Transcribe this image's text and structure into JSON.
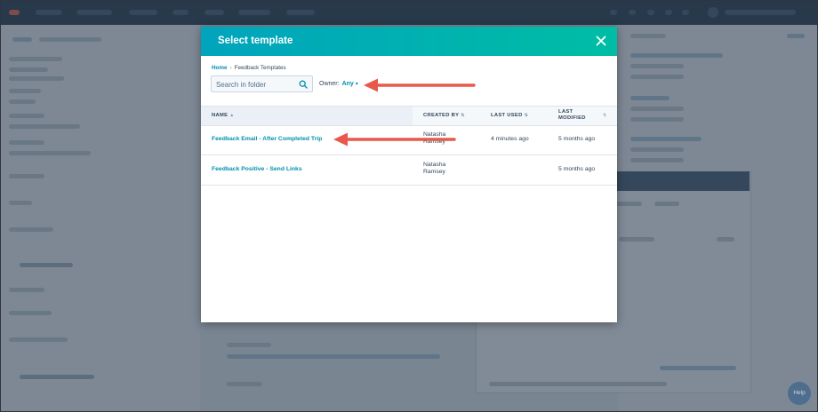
{
  "modal": {
    "title": "Select template",
    "breadcrumb": {
      "home": "Home",
      "separator": "›",
      "current": "Feedback Templates"
    },
    "search": {
      "placeholder": "Search in folder",
      "value": ""
    },
    "owner": {
      "label": "Owner:",
      "value": "Any"
    },
    "table": {
      "columns": {
        "name": "NAME",
        "created_by": "CREATED BY",
        "last_used": "LAST USED",
        "last_modified": "LAST MODIFIED"
      },
      "rows": [
        {
          "name": "Feedback Email - After Completed Trip",
          "created_by": "Natasha Ramsey",
          "last_used": "4 minutes ago",
          "last_modified": "5 months ago"
        },
        {
          "name": "Feedback Positive - Send Links",
          "created_by": "Natasha Ramsey",
          "last_used": "",
          "last_modified": "5 months ago"
        }
      ]
    }
  },
  "help": {
    "label": "Help"
  },
  "colors": {
    "header_start": "#00a4bd",
    "header_end": "#00bda5",
    "link": "#0091ae",
    "annotation_arrow": "#e8594b"
  },
  "icons": {
    "close": "close-icon",
    "search": "search-icon",
    "sort": "sort-icon",
    "caret": "chevron-down-icon"
  }
}
